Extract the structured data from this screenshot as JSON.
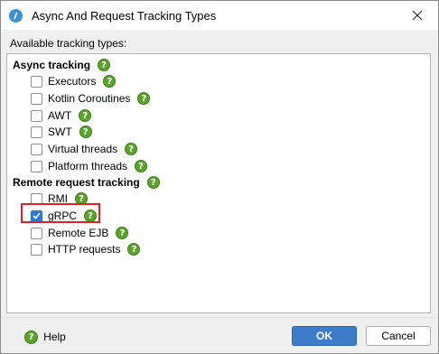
{
  "window": {
    "title": "Async And Request Tracking Types"
  },
  "available_label": "Available tracking types:",
  "groups": [
    {
      "label": "Async tracking",
      "items": [
        {
          "label": "Executors",
          "checked": false
        },
        {
          "label": "Kotlin Coroutines",
          "checked": false
        },
        {
          "label": "AWT",
          "checked": false
        },
        {
          "label": "SWT",
          "checked": false
        },
        {
          "label": "Virtual threads",
          "checked": false
        },
        {
          "label": "Platform threads",
          "checked": false
        }
      ]
    },
    {
      "label": "Remote request tracking",
      "items": [
        {
          "label": "RMI",
          "checked": false
        },
        {
          "label": "gRPC",
          "checked": true
        },
        {
          "label": "Remote EJB",
          "checked": false
        },
        {
          "label": "HTTP requests",
          "checked": false
        }
      ]
    }
  ],
  "buttons": {
    "help": "Help",
    "ok": "OK",
    "cancel": "Cancel"
  },
  "icons": {
    "help_badge": "?"
  },
  "colors": {
    "accent": "#3c7cc9",
    "help_green": "#5ba32b",
    "highlight": "#e0202a"
  }
}
